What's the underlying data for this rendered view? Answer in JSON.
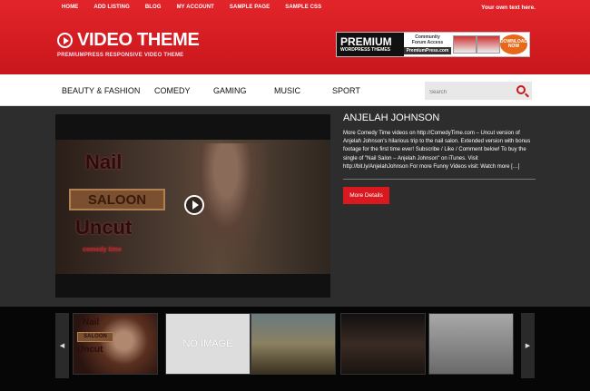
{
  "topnav": {
    "items": [
      "HOME",
      "ADD LISTING",
      "BLOG",
      "MY ACCOUNT",
      "SAMPLE PAGE",
      "SAMPLE CSS"
    ],
    "right_text": "Your own text here."
  },
  "logo": {
    "title": "VIDEO THEME",
    "subtitle": "PREMIUMPRESS RESPONSIVE VIDEO THEME"
  },
  "banner": {
    "premium": "PREMIUM",
    "wordpress": "WORDPRESS THEMES",
    "community": "Community",
    "forum": "Forum Access",
    "site": "PremiumPress.com",
    "download": "DOWNLOAD NOW"
  },
  "categories": [
    "BEAUTY & FASHION",
    "COMEDY",
    "GAMING",
    "MUSIC",
    "SPORT"
  ],
  "search": {
    "placeholder": "Search"
  },
  "featured": {
    "title": "ANJELAH JOHNSON",
    "description": "More Comedy Time videos on http://ComedyTime.com – Uncut version of Anjelah Johnson's hilarious trip to the nail salon. Extended version with bonus footage for the first time ever! Subscribe / Like / Comment below! To buy the single of \"Nail Salon – Anjelah Johnson\" on iTunes. Visit http://bit.ly/AnjelahJohnson  For more Funny Videos visit: Watch more […]",
    "button": "More Details",
    "video_text": {
      "line1": "Nail",
      "line2": "SALOON",
      "line3": "Uncut",
      "brand": "comedy time"
    }
  },
  "carousel": {
    "prev": "◀",
    "next": "▶",
    "no_image": "NO IMAGE",
    "thumb1_text": {
      "line1": "Nail",
      "line2": "SALOON",
      "line3": "Uncut"
    }
  },
  "colors": {
    "brand_red": "#d9191f",
    "header_dark_red": "#c8161c",
    "content_bg": "#2d2d2d"
  }
}
